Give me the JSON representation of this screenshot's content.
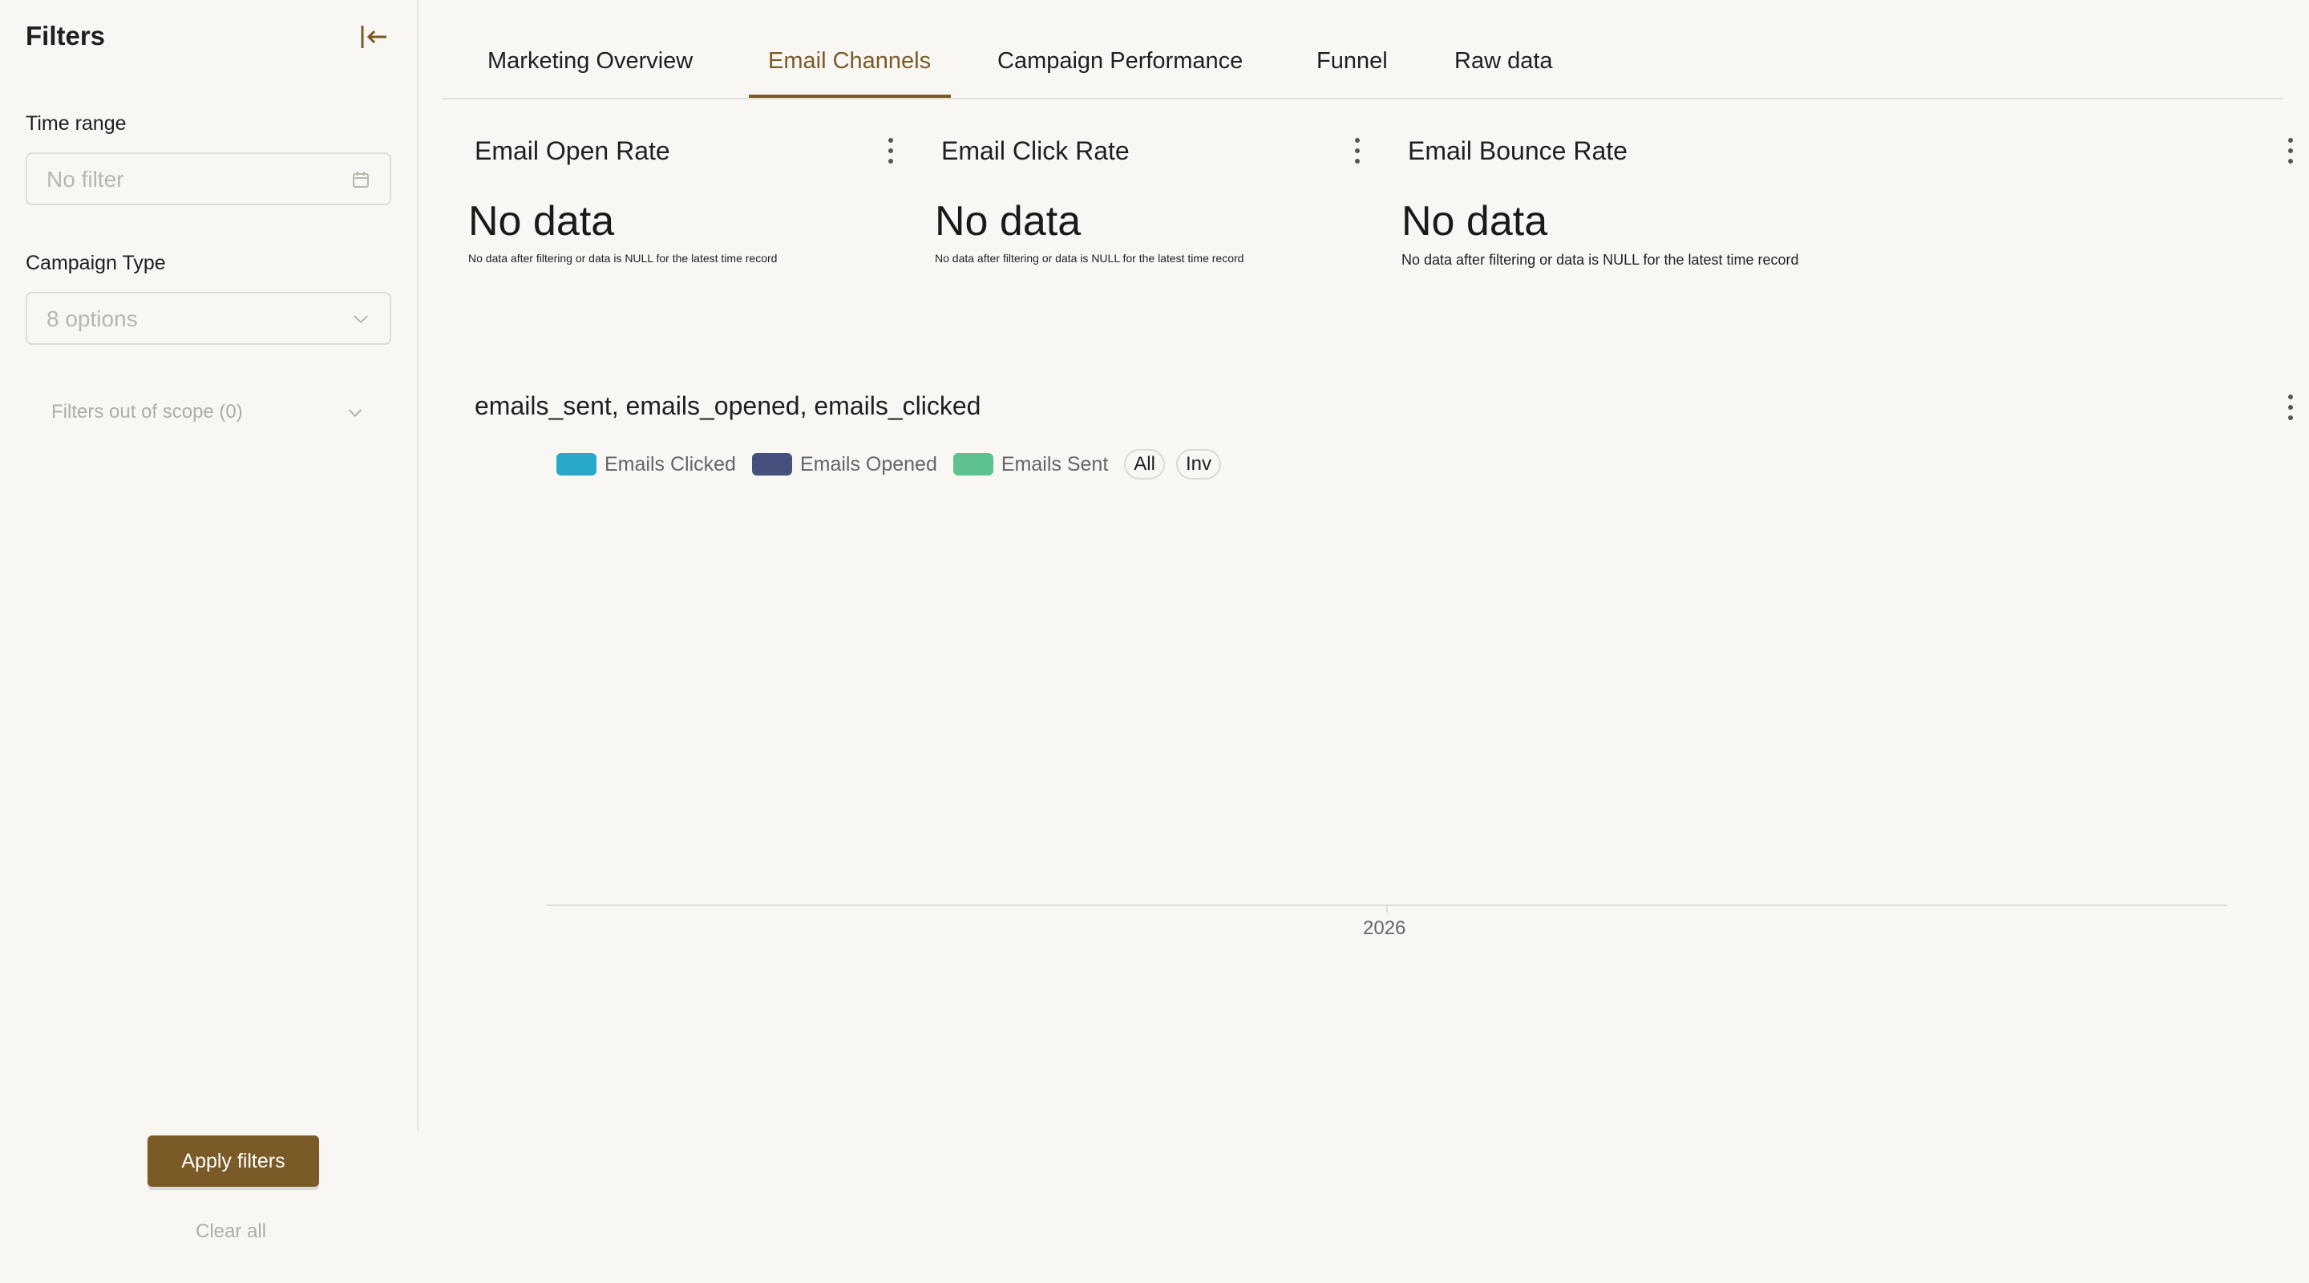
{
  "sidebar": {
    "title": "Filters",
    "time_range": {
      "label": "Time range",
      "placeholder": "No filter"
    },
    "campaign_type": {
      "label": "Campaign Type",
      "placeholder": "8 options"
    },
    "out_of_scope": "Filters out of scope (0)",
    "apply_label": "Apply filters",
    "clear_label": "Clear all"
  },
  "tabs": [
    {
      "label": "Marketing Overview",
      "active": false
    },
    {
      "label": "Email Channels",
      "active": true
    },
    {
      "label": "Campaign Performance",
      "active": false
    },
    {
      "label": "Funnel",
      "active": false
    },
    {
      "label": "Raw data",
      "active": false
    }
  ],
  "kpis": [
    {
      "title": "Email Open Rate",
      "value": "No data",
      "note": "No data after filtering or data is NULL for the latest time record"
    },
    {
      "title": "Email Click Rate",
      "value": "No data",
      "note": "No data after filtering or data is NULL for the latest time record"
    },
    {
      "title": "Email Bounce Rate",
      "value": "No data",
      "note": "No data after filtering or data is NULL for the latest time record"
    }
  ],
  "chart": {
    "title": "emails_sent, emails_opened, emails_clicked",
    "legend": [
      {
        "name": "Emails Clicked",
        "color": "#29a9c9"
      },
      {
        "name": "Emails Opened",
        "color": "#46507c"
      },
      {
        "name": "Emails Sent",
        "color": "#5dc28f"
      }
    ],
    "legend_buttons": [
      "All",
      "Inv"
    ],
    "x_tick": "2026"
  },
  "colors": {
    "accent": "#7a5a27",
    "background": "#f8f7f4"
  }
}
